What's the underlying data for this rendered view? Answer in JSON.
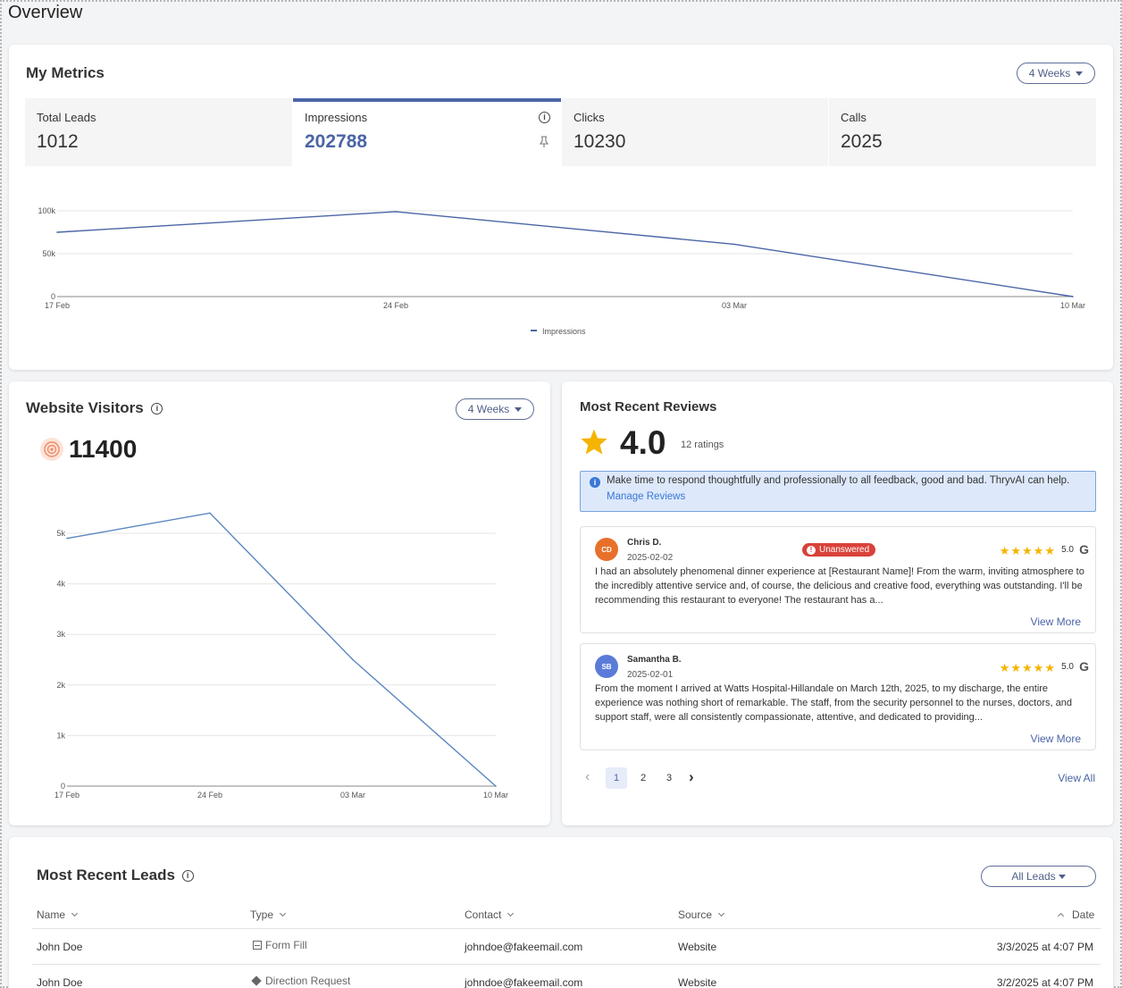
{
  "page": {
    "title": "Overview"
  },
  "metrics": {
    "title": "My Metrics",
    "range_label": "4 Weeks",
    "tiles": [
      {
        "label": "Total Leads",
        "value": "1012"
      },
      {
        "label": "Impressions",
        "value": "202788"
      },
      {
        "label": "Clicks",
        "value": "10230"
      },
      {
        "label": "Calls",
        "value": "2025"
      }
    ],
    "legend_label": "Impressions",
    "accent_color": "#4b65a6"
  },
  "visitors": {
    "title": "Website Visitors",
    "range_label": "4 Weeks",
    "total": "11400"
  },
  "reviews": {
    "title": "Most Recent Reviews",
    "rating": "4.0",
    "ratings_count": "12 ratings",
    "notice_text": "Make time to respond thoughtfully and professionally to all feedback, good and bad. ThryvAI can help.",
    "notice_link": "Manage Reviews",
    "items": [
      {
        "initials": "CD",
        "avatar_color": "#e8702a",
        "name": "Chris D.",
        "date": "2025-02-02",
        "badge": "Unanswered",
        "stars": "★★★★★",
        "score": "5.0",
        "text": "I had an absolutely phenomenal dinner experience at [Restaurant Name]! From the warm, inviting atmosphere to the incredibly attentive service and, of course, the delicious and creative food, everything was outstanding. I'll be recommending this restaurant to everyone! The restaurant has a...",
        "more": "View More"
      },
      {
        "initials": "SB",
        "avatar_color": "#5a7bd8",
        "name": "Samantha B.",
        "date": "2025-02-01",
        "stars": "★★★★★",
        "score": "5.0",
        "text": "From the moment I arrived at Watts Hospital-Hillandale on March 12th, 2025, to my discharge, the entire experience was nothing short of remarkable. The staff, from the security personnel to the nurses, doctors, and support staff, were all consistently compassionate, attentive, and dedicated to providing...",
        "more": "View More"
      }
    ],
    "pages": [
      "1",
      "2",
      "3"
    ],
    "view_all": "View All"
  },
  "leads": {
    "title": "Most Recent Leads",
    "filter_label": "All Leads",
    "columns": [
      "Name",
      "Type",
      "Contact",
      "Source",
      "Date"
    ],
    "rows": [
      {
        "name": "John Doe",
        "type": "Form Fill",
        "contact": "johndoe@fakeemail.com",
        "source": "Website",
        "date": "3/3/2025 at 4:07 PM"
      },
      {
        "name": "John Doe",
        "type": "Direction Request",
        "contact": "johndoe@fakeemail.com",
        "source": "Website",
        "date": "3/2/2025 at 4:07 PM"
      }
    ]
  },
  "chart_data": [
    {
      "type": "line",
      "x": [
        "17 Feb",
        "24 Feb",
        "03 Mar",
        "10 Mar"
      ],
      "series": [
        {
          "name": "Impressions",
          "values": [
            75000,
            99000,
            61000,
            0
          ]
        }
      ],
      "yticks": [
        "0",
        "50k",
        "100k"
      ],
      "ylim": [
        0,
        100000
      ],
      "grid": true,
      "legend": "bottom"
    },
    {
      "type": "line",
      "x": [
        "17 Feb",
        "24 Feb",
        "03 Mar",
        "10 Mar"
      ],
      "series": [
        {
          "values": [
            4900,
            5400,
            2500,
            0
          ]
        }
      ],
      "yticks": [
        "0",
        "1k",
        "2k",
        "3k",
        "4k",
        "5k"
      ],
      "ylim": [
        0,
        5000
      ],
      "grid": true
    }
  ]
}
